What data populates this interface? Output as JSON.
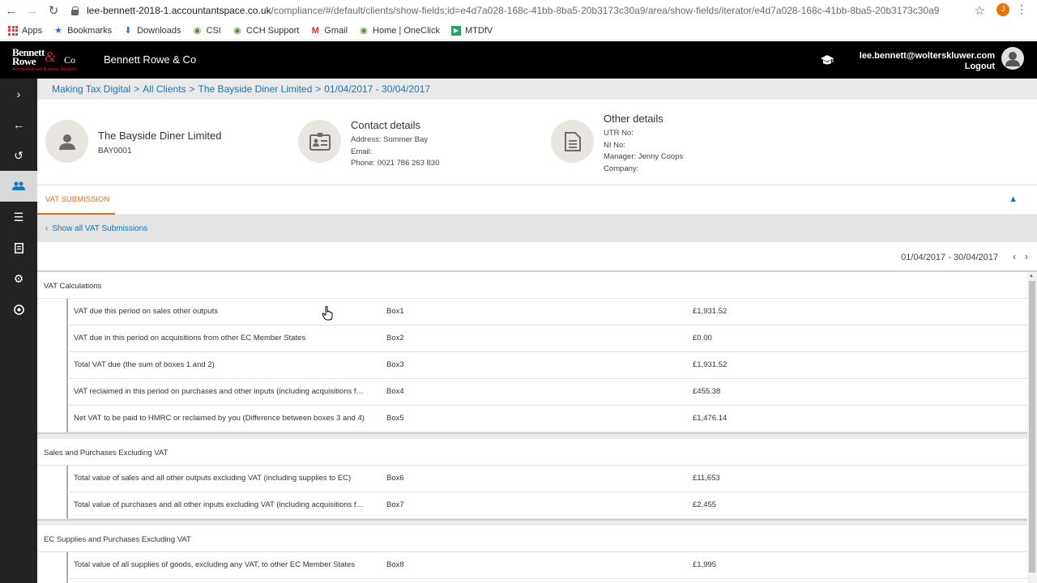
{
  "browser": {
    "url_host": "lee-bennett-2018-1.accountantspace.co.uk",
    "url_path": "/compliance/#/default/clients/show-fields;id=e4d7a028-168c-41bb-8ba5-20b3173c30a9/area/show-fields/iterator/e4d7a028-168c-41bb-8ba5-20b3173c30a9",
    "profile_initial": "J",
    "bookmarks": [
      "Apps",
      "Bookmarks",
      "Downloads",
      "CSI",
      "CCH Support",
      "Gmail",
      "Home | OneClick",
      "MTDfV"
    ]
  },
  "header": {
    "logo_line1": "Bennett",
    "logo_line2": "Rowe",
    "logo_amp": "&",
    "logo_co": "Co",
    "logo_tagline": "Accountants and Business Advisers",
    "firm_name": "Bennett Rowe & Co",
    "user_email": "lee.bennett@wolterskluwer.com",
    "logout_label": "Logout"
  },
  "breadcrumb": {
    "items": [
      "Making Tax Digital",
      "All Clients",
      "The Bayside Diner Limited",
      "01/04/2017 - 30/04/2017"
    ],
    "separator": ">"
  },
  "client": {
    "name": "The Bayside Diner Limited",
    "code": "BAY0001",
    "contact_title": "Contact details",
    "address": "Address: Summer Bay",
    "email": "Email:",
    "phone": "Phone: 0021 786 263 830",
    "other_title": "Other details",
    "utr": "UTR No:",
    "ni": "NI No:",
    "manager": "Manager: Jenny Coops",
    "company": "Company:"
  },
  "tab": {
    "label": "VAT SUBMISSION"
  },
  "show_all_label": "Show all VAT Submissions",
  "period": "01/04/2017 - 30/04/2017",
  "groups": [
    {
      "title": "VAT Calculations",
      "rows": [
        {
          "desc": "VAT due this period on sales other outputs",
          "box": "Box1",
          "value": "£1,931.52"
        },
        {
          "desc": "VAT due in this period on acquisitions from other EC Member States",
          "box": "Box2",
          "value": "£0.00"
        },
        {
          "desc": "Total VAT due (the sum of boxes 1 and 2)",
          "box": "Box3",
          "value": "£1,931.52"
        },
        {
          "desc": "VAT reclaimed in this period on purchases and other inputs (including acquisitions from the EC)",
          "box": "Box4",
          "value": "£455.38"
        },
        {
          "desc": "Net VAT to be paid to HMRC or reclaimed by you (Difference between boxes 3 and 4)",
          "box": "Box5",
          "value": "£1,476.14"
        }
      ]
    },
    {
      "title": "Sales and Purchases Excluding VAT",
      "rows": [
        {
          "desc": "Total value of sales and all other outputs excluding VAT (including supplies to EC)",
          "box": "Box6",
          "value": "£11,653"
        },
        {
          "desc": "Total value of purchases and all other inputs excluding VAT (including acquisitions from the EC)",
          "box": "Box7",
          "value": "£2,455"
        }
      ]
    },
    {
      "title": "EC Supplies and Purchases Excluding VAT",
      "rows": [
        {
          "desc": "Total value of all supplies of goods, excluding any VAT, to other EC Member States",
          "box": "Box8",
          "value": "£1,995"
        }
      ]
    }
  ],
  "colors": {
    "accent_orange": "#e86c1d",
    "link_blue": "#1976b3",
    "header_black": "#000000",
    "sidebar_dark": "#232323"
  }
}
